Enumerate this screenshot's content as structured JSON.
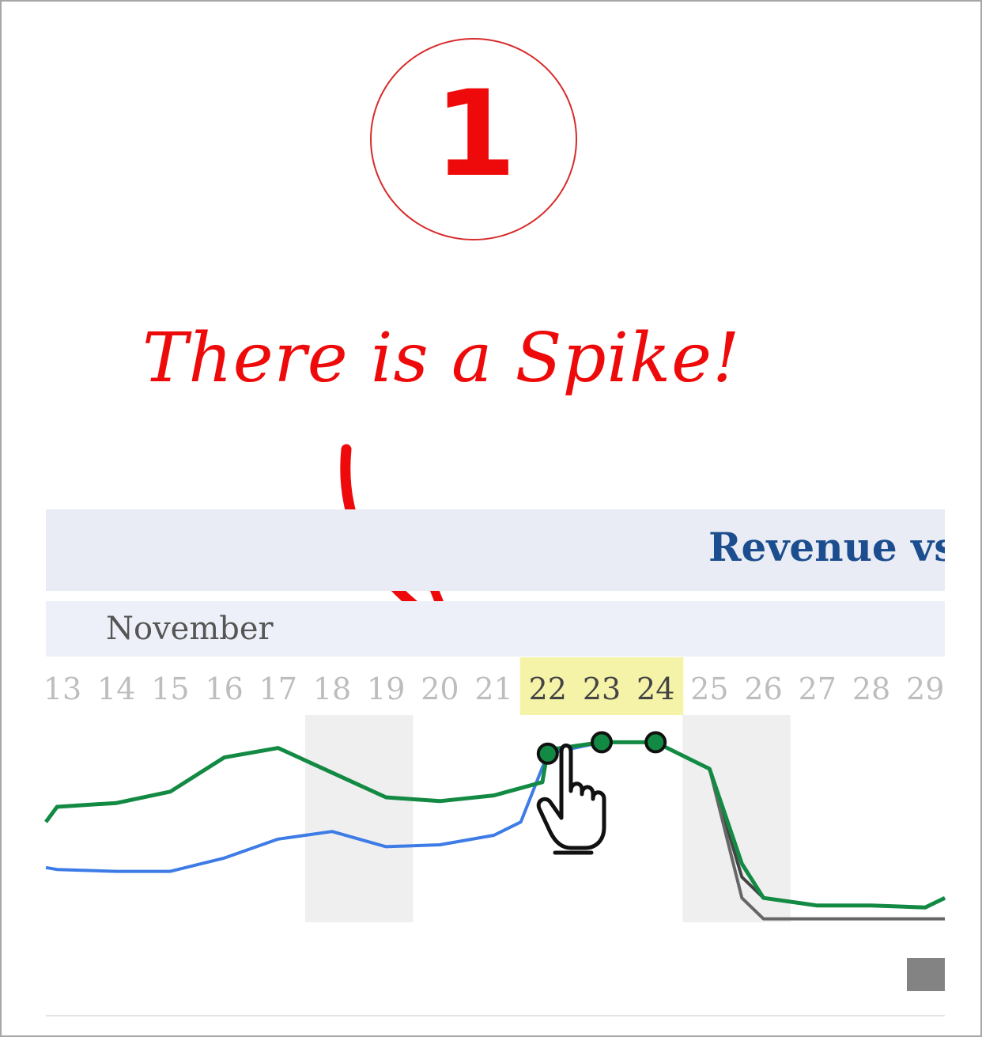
{
  "step": {
    "number": "1"
  },
  "callout": {
    "text": "There is a Spike!"
  },
  "chart": {
    "title": "Revenue vs",
    "month": "November"
  },
  "colors": {
    "annotation": "#ee0a0a",
    "green_series": "#138a43",
    "blue_series": "#3d7be6",
    "grey_series": "#444444",
    "highlight": "#f5f3a8",
    "weekend_band": "#efefef"
  },
  "icons": {
    "pointer": "hand-pointer-icon",
    "arrow": "curved-arrow-icon"
  },
  "chart_data": {
    "type": "line",
    "title": "Revenue vs",
    "x": [
      "13",
      "14",
      "15",
      "16",
      "17",
      "18",
      "19",
      "20",
      "21",
      "22",
      "23",
      "24",
      "25",
      "26",
      "27",
      "28",
      "29"
    ],
    "x_group_label": "November",
    "highlighted_x": [
      "22",
      "23",
      "24"
    ],
    "shaded_x_ranges": [
      [
        "18",
        "19"
      ],
      [
        "25",
        "26"
      ]
    ],
    "ylim": [
      0,
      100
    ],
    "y_axis_visible": false,
    "grid": false,
    "series": [
      {
        "values": [
          52,
          60,
          62,
          68,
          86,
          91,
          78,
          65,
          63,
          66,
          73,
          90,
          94,
          94,
          80,
          30,
          12,
          8,
          8,
          7,
          12
        ]
      },
      {
        "values": [
          28,
          27,
          26,
          26,
          33,
          43,
          47,
          39,
          40,
          45,
          52,
          88,
          94,
          94,
          80
        ]
      },
      {
        "values": [
          80,
          23,
          12,
          8,
          8,
          7,
          12
        ]
      },
      {
        "values": [
          80,
          12,
          1,
          1,
          1,
          1,
          1
        ]
      }
    ],
    "series_x": [
      [
        12.0,
        12.9,
        14.0,
        15.0,
        16.0,
        17.0,
        18.0,
        19.0,
        20.0,
        21.0,
        21.9,
        22.0,
        23.0,
        24.0,
        25.0,
        25.6,
        26.0,
        27.0,
        28.0,
        29.0,
        29.5
      ],
      [
        12.0,
        12.9,
        14.0,
        15.0,
        16.0,
        17.0,
        18.0,
        19.0,
        20.0,
        21.0,
        21.5,
        22.0,
        23.0,
        24.0,
        25.0
      ],
      [
        25.0,
        25.6,
        26.0,
        27.0,
        28.0,
        29.0,
        29.5
      ],
      [
        25.0,
        25.6,
        26.0,
        27.0,
        28.0,
        29.0,
        29.5
      ]
    ],
    "marked_points": {
      "x": [
        "22",
        "23",
        "24"
      ],
      "values": [
        88,
        94,
        94
      ]
    }
  }
}
